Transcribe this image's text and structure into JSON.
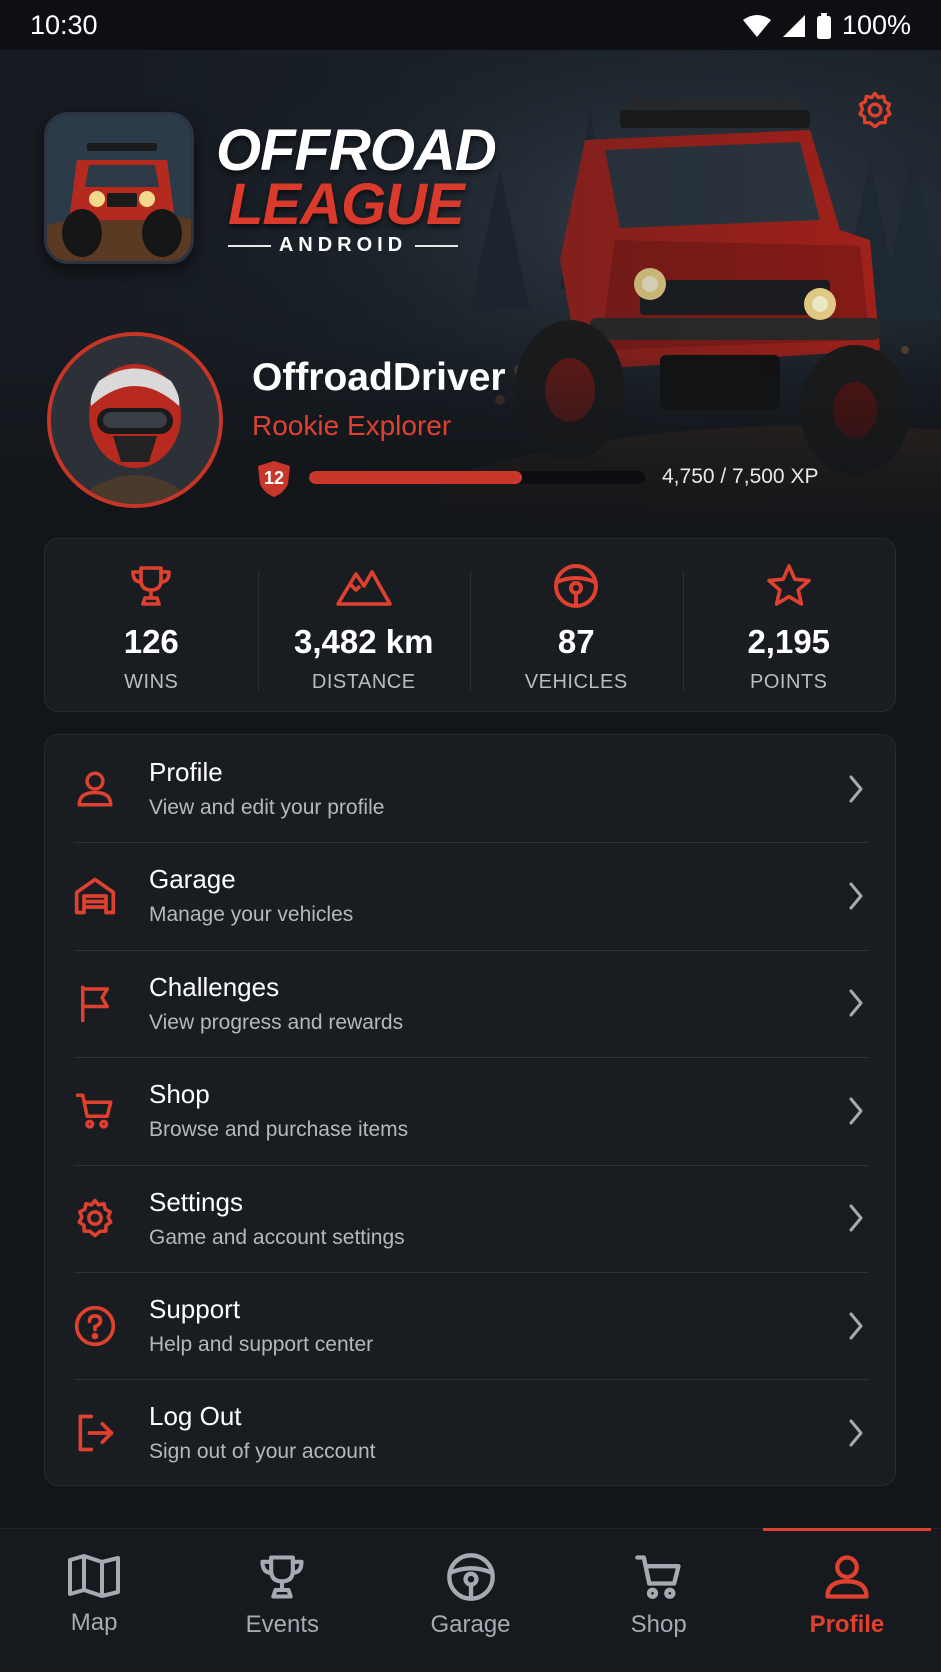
{
  "status_bar": {
    "time": "10:30",
    "battery": "100%",
    "icons": [
      "wifi-icon",
      "signal-icon",
      "battery-icon"
    ]
  },
  "app": {
    "logo_line1": "OFFROAD",
    "logo_line2": "LEAGUE",
    "logo_line3": "ANDROID",
    "settings_icon": "gear-icon"
  },
  "player": {
    "name": "OffroadDriver",
    "rank": "Rookie Explorer",
    "level": "12",
    "xp_text": "4,750 / 7,500 XP",
    "xp_current": 4750,
    "xp_max": 7500
  },
  "stats": [
    {
      "icon": "trophy-icon",
      "value": "126",
      "label": "WINS"
    },
    {
      "icon": "mountain-icon",
      "value": "3,482 km",
      "label": "DISTANCE"
    },
    {
      "icon": "steering-wheel-icon",
      "value": "87",
      "label": "VEHICLES"
    },
    {
      "icon": "star-icon",
      "value": "2,195",
      "label": "POINTS"
    }
  ],
  "menu": [
    {
      "icon": "user-icon",
      "title": "Profile",
      "subtitle": "View and edit your profile"
    },
    {
      "icon": "garage-icon",
      "title": "Garage",
      "subtitle": "Manage your vehicles"
    },
    {
      "icon": "flag-icon",
      "title": "Challenges",
      "subtitle": "View progress and rewards"
    },
    {
      "icon": "cart-icon",
      "title": "Shop",
      "subtitle": "Browse and purchase items"
    },
    {
      "icon": "gear-icon",
      "title": "Settings",
      "subtitle": "Game and account settings"
    },
    {
      "icon": "help-icon",
      "title": "Support",
      "subtitle": "Help and support center"
    },
    {
      "icon": "logout-icon",
      "title": "Log Out",
      "subtitle": "Sign out of your account"
    }
  ],
  "nav": [
    {
      "icon": "map-icon",
      "label": "Map",
      "active": false
    },
    {
      "icon": "trophy-icon",
      "label": "Events",
      "active": false
    },
    {
      "icon": "steering-wheel-icon",
      "label": "Garage",
      "active": false
    },
    {
      "icon": "cart-icon",
      "label": "Shop",
      "active": false
    },
    {
      "icon": "user-icon",
      "label": "Profile",
      "active": true
    }
  ],
  "colors": {
    "accent": "#e0412f",
    "background": "#121519",
    "card": "#191d22",
    "muted": "#a7abb1"
  }
}
